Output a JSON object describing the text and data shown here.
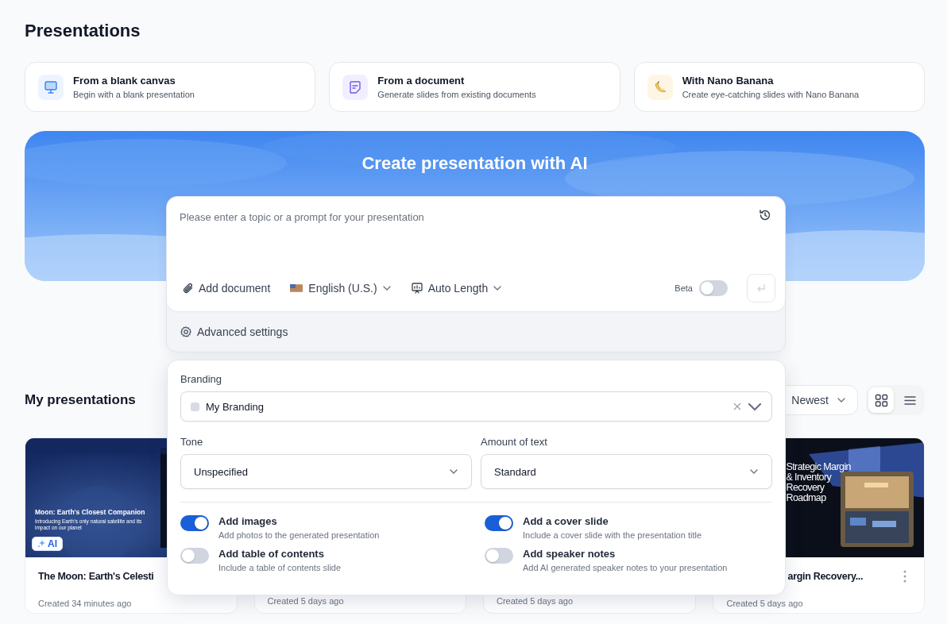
{
  "page_title": "Presentations",
  "create_options": [
    {
      "kind": "canvas",
      "title": "From a blank canvas",
      "subtitle": "Begin with a blank presentation"
    },
    {
      "kind": "document",
      "title": "From a document",
      "subtitle": "Generate slides from existing documents"
    },
    {
      "kind": "banana",
      "title": "With Nano Banana",
      "subtitle": "Create eye-catching slides with Nano Banana"
    }
  ],
  "hero": {
    "title": "Create presentation with AI"
  },
  "prompt": {
    "placeholder": "Please enter a topic or a prompt for your presentation",
    "attach_label": "Add document",
    "language": "English (U.S.)",
    "length": "Auto Length",
    "beta_label": "Beta",
    "beta_on": false,
    "advanced_label": "Advanced settings"
  },
  "settings": {
    "branding_label": "Branding",
    "branding_value": "My Branding",
    "tone_label": "Tone",
    "tone_value": "Unspecified",
    "amount_label": "Amount of text",
    "amount_value": "Standard",
    "toggles": [
      {
        "label": "Add images",
        "description": "Add photos to the generated presentation",
        "on": true
      },
      {
        "label": "Add a cover slide",
        "description": "Include a cover slide with the presentation title",
        "on": true
      },
      {
        "label": "Add table of contents",
        "description": "Include a table of contents slide",
        "on": false
      },
      {
        "label": "Add speaker notes",
        "description": "Add AI generated speaker notes to your presentation",
        "on": false
      }
    ]
  },
  "my_presentations": {
    "title": "My presentations",
    "sort": "Newest",
    "views": [
      {
        "kind": "grid",
        "selected": true
      },
      {
        "kind": "list",
        "selected": false
      }
    ],
    "cards": [
      {
        "kind": "moon",
        "slide_title": "Moon: Earth's Closest Companion",
        "slide_subtitle": "Introducing Earth's only natural satellite and its impact on our planet",
        "badge": "AI",
        "title": "The Moon: Earth's Celesti",
        "created": "Created 34 minutes ago"
      },
      {
        "kind": "hidden",
        "created": "Created 5 days ago"
      },
      {
        "kind": "hidden",
        "created": "Created 5 days ago"
      },
      {
        "kind": "store",
        "slide_title": "Strategic Margin & Inventory Recovery Roadmap",
        "title": "argin Recovery...",
        "created": "Created 5 days ago"
      }
    ]
  }
}
